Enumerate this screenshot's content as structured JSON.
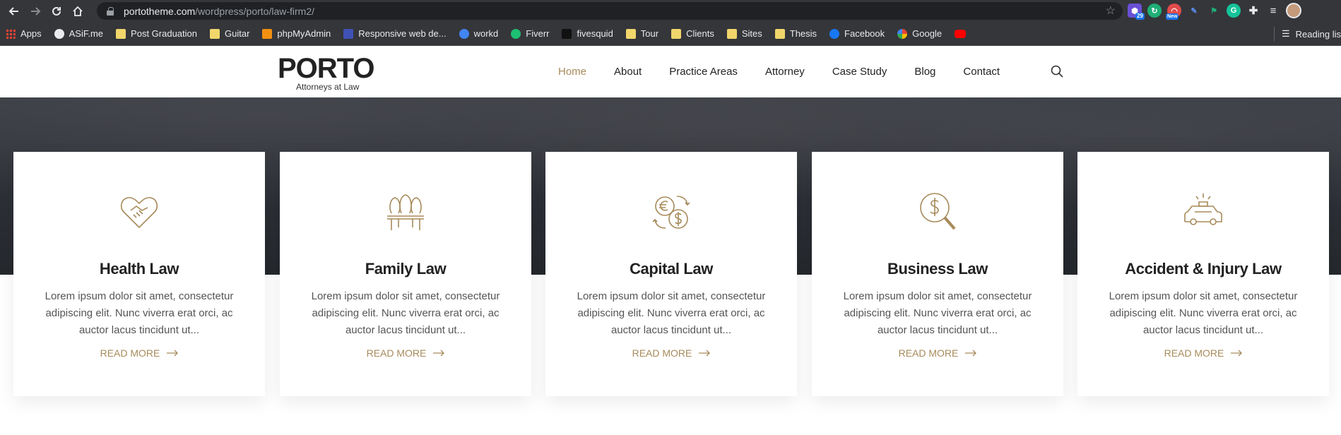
{
  "browser": {
    "url_host": "portotheme.com",
    "url_path": "/wordpress/porto/law-firm2/",
    "extensions": [
      {
        "name": "puzzle-badge-icon",
        "badge": "29",
        "color": "#6a4fd6"
      },
      {
        "name": "green-circle-icon",
        "badge": "",
        "color": "#1fae76"
      },
      {
        "name": "rainbow-new-icon",
        "badge": "New",
        "color": "#e24b4b"
      },
      {
        "name": "pen-icon",
        "badge": "",
        "color": "#5b8def"
      },
      {
        "name": "flag-icon",
        "badge": "",
        "color": "#1fae76"
      },
      {
        "name": "grammarly-icon",
        "badge": "",
        "color": "#15c39a"
      },
      {
        "name": "extensions-puzzle-icon",
        "badge": "",
        "color": "#9aa0a6"
      },
      {
        "name": "playlist-icon",
        "badge": "",
        "color": "#9aa0a6"
      }
    ],
    "bookmarks": [
      {
        "label": "Apps",
        "icon": "apps-grid-icon"
      },
      {
        "label": "ASiF.me",
        "icon": "globe-icon"
      },
      {
        "label": "Post Graduation",
        "icon": "folder-icon"
      },
      {
        "label": "Guitar",
        "icon": "folder-icon"
      },
      {
        "label": "phpMyAdmin",
        "icon": "phpmyadmin-icon"
      },
      {
        "label": "Responsive web de...",
        "icon": "w-icon"
      },
      {
        "label": "workd",
        "icon": "workd-icon"
      },
      {
        "label": "Fiverr",
        "icon": "fiverr-icon"
      },
      {
        "label": "fivesquid",
        "icon": "fivesquid-icon"
      },
      {
        "label": "Tour",
        "icon": "folder-icon"
      },
      {
        "label": "Clients",
        "icon": "folder-icon"
      },
      {
        "label": "Sites",
        "icon": "folder-icon"
      },
      {
        "label": "Thesis",
        "icon": "folder-icon"
      },
      {
        "label": "Facebook",
        "icon": "facebook-icon"
      },
      {
        "label": "Google",
        "icon": "google-icon"
      },
      {
        "label": "",
        "icon": "youtube-icon"
      }
    ],
    "reading_list": "Reading lis"
  },
  "site": {
    "logo_word": "PORTO",
    "logo_tagline": "Attorneys at Law",
    "nav": [
      {
        "label": "Home",
        "active": true
      },
      {
        "label": "About",
        "active": false
      },
      {
        "label": "Practice Areas",
        "active": false
      },
      {
        "label": "Attorney",
        "active": false
      },
      {
        "label": "Case Study",
        "active": false
      },
      {
        "label": "Blog",
        "active": false
      },
      {
        "label": "Contact",
        "active": false
      }
    ],
    "accent_color": "#a78a5a"
  },
  "cards": [
    {
      "title": "Health Law",
      "icon": "handshake-heart-icon",
      "text": "Lorem ipsum dolor sit amet, consectetur adipiscing elit. Nunc viverra erat orci, ac auctor lacus tincidunt ut...",
      "link": "READ MORE"
    },
    {
      "title": "Family Law",
      "icon": "family-table-icon",
      "text": "Lorem ipsum dolor sit amet, consectetur adipiscing elit. Nunc viverra erat orci, ac auctor lacus tincidunt ut...",
      "link": "READ MORE"
    },
    {
      "title": "Capital Law",
      "icon": "currency-exchange-icon",
      "text": "Lorem ipsum dolor sit amet, consectetur adipiscing elit. Nunc viverra erat orci, ac auctor lacus tincidunt ut...",
      "link": "READ MORE"
    },
    {
      "title": "Business Law",
      "icon": "dollar-search-icon",
      "text": "Lorem ipsum dolor sit amet, consectetur adipiscing elit. Nunc viverra erat orci, ac auctor lacus tincidunt ut...",
      "link": "READ MORE"
    },
    {
      "title": "Accident & Injury Law",
      "icon": "car-accident-icon",
      "text": "Lorem ipsum dolor sit amet, consectetur adipiscing elit. Nunc viverra erat orci, ac auctor lacus tincidunt ut...",
      "link": "READ MORE"
    }
  ]
}
